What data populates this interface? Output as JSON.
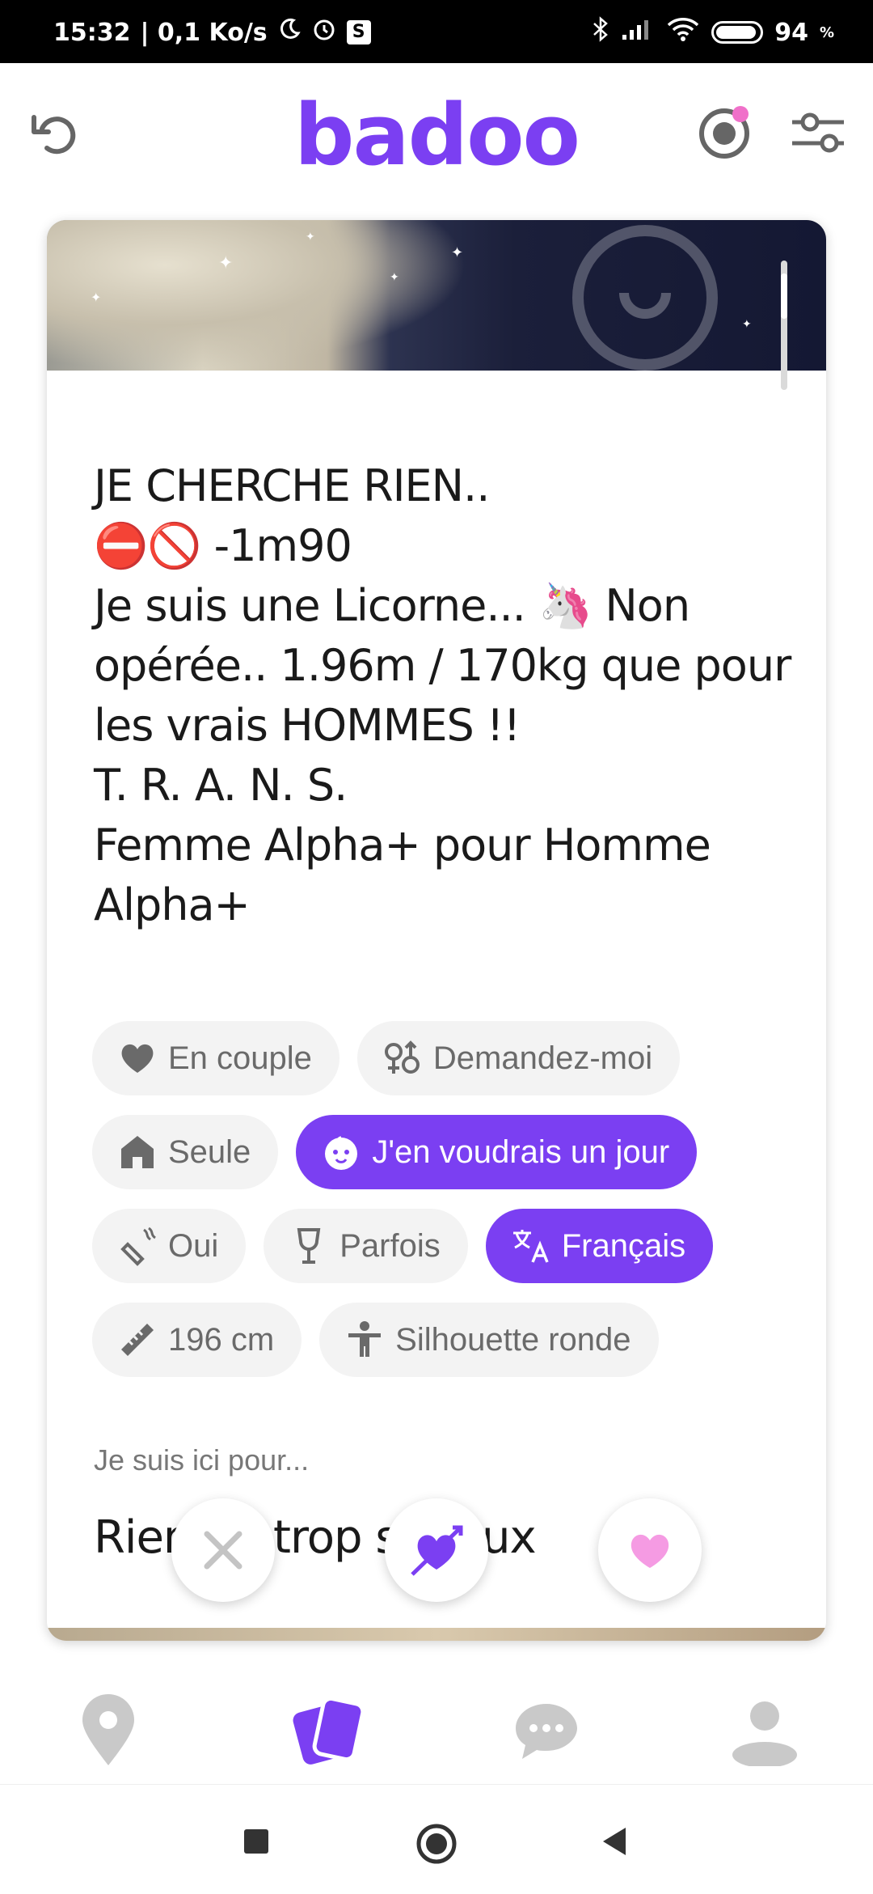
{
  "status_bar": {
    "time": "15:32",
    "speed": "| 0,1 Ko/s",
    "s_badge": "S",
    "battery": "94",
    "battery_unit": "%"
  },
  "header": {
    "logo": "badoo",
    "brand_color": "#7b3ff2"
  },
  "profile": {
    "bio_lines": [
      "JE CHERCHE RIEN..",
      "⛔🚫 -1m90",
      "Je suis une Licorne... 🦄 Non",
      "opérée.. 1.96m / 170kg que pour",
      "les vrais HOMMES !!",
      "T. R. A. N. S.",
      "Femme Alpha+ pour Homme",
      "Alpha+"
    ],
    "chips": [
      {
        "label": "En couple",
        "icon": "heart-icon"
      },
      {
        "label": "Demandez-moi",
        "icon": "gender-icon"
      },
      {
        "label": "Seule",
        "icon": "house-icon"
      },
      {
        "label": "J'en voudrais un jour",
        "icon": "baby-icon"
      },
      {
        "label": "Oui",
        "icon": "smoking-icon"
      },
      {
        "label": "Parfois",
        "icon": "wine-glass-icon"
      },
      {
        "label": "Français",
        "icon": "translate-icon"
      },
      {
        "label": "196 cm",
        "icon": "ruler-icon"
      },
      {
        "label": "Silhouette ronde",
        "icon": "body-icon"
      }
    ],
    "here_for_label": "Je suis ici pour...",
    "here_for_value": "Rien de trop sérieux"
  },
  "actions": {
    "dislike": "close-icon",
    "crush": "heart-arrow-icon",
    "like": "heart-icon"
  },
  "bottom_nav": [
    "location-pin-icon",
    "cards-icon",
    "chat-icon",
    "profile-icon"
  ],
  "system_nav": [
    "recents-square-icon",
    "home-circle-icon",
    "back-triangle-icon"
  ]
}
